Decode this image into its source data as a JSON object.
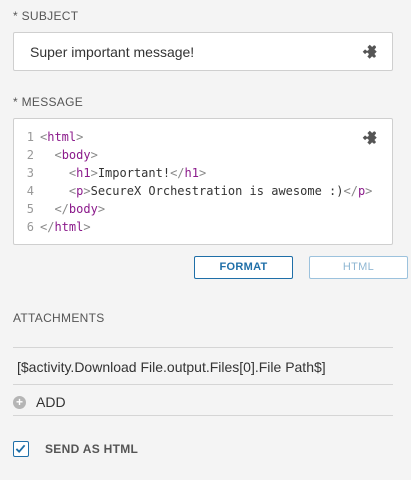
{
  "subject": {
    "label": "* SUBJECT",
    "value": "Super important message!"
  },
  "message": {
    "label": "* MESSAGE",
    "lines": [
      {
        "num": "1",
        "indent": "",
        "parts": [
          {
            "t": "br",
            "v": "<"
          },
          {
            "t": "tag",
            "v": "html"
          },
          {
            "t": "br",
            "v": ">"
          }
        ]
      },
      {
        "num": "2",
        "indent": "  ",
        "parts": [
          {
            "t": "br",
            "v": "<"
          },
          {
            "t": "tag",
            "v": "body"
          },
          {
            "t": "br",
            "v": ">"
          }
        ]
      },
      {
        "num": "3",
        "indent": "    ",
        "parts": [
          {
            "t": "br",
            "v": "<"
          },
          {
            "t": "tag",
            "v": "h1"
          },
          {
            "t": "br",
            "v": ">"
          },
          {
            "t": "txt",
            "v": "Important!"
          },
          {
            "t": "br",
            "v": "</"
          },
          {
            "t": "tag",
            "v": "h1"
          },
          {
            "t": "br",
            "v": ">"
          }
        ]
      },
      {
        "num": "4",
        "indent": "    ",
        "parts": [
          {
            "t": "br",
            "v": "<"
          },
          {
            "t": "tag",
            "v": "p"
          },
          {
            "t": "br",
            "v": ">"
          },
          {
            "t": "txt",
            "v": "SecureX Orchestration is awesome :)"
          },
          {
            "t": "br",
            "v": "</"
          },
          {
            "t": "tag",
            "v": "p"
          },
          {
            "t": "br",
            "v": ">"
          }
        ]
      },
      {
        "num": "5",
        "indent": "  ",
        "parts": [
          {
            "t": "br",
            "v": "</"
          },
          {
            "t": "tag",
            "v": "body"
          },
          {
            "t": "br",
            "v": ">"
          }
        ]
      },
      {
        "num": "6",
        "indent": "",
        "parts": [
          {
            "t": "br",
            "v": "</"
          },
          {
            "t": "tag",
            "v": "html"
          },
          {
            "t": "br",
            "v": ">"
          }
        ]
      }
    ]
  },
  "buttons": {
    "format": "FORMAT",
    "html": "HTML"
  },
  "attachments": {
    "label": "ATTACHMENTS",
    "items": [
      "[$activity.Download File.output.Files[0].File Path$]"
    ],
    "add_label": "ADD"
  },
  "send_as_html": {
    "label": "SEND AS HTML",
    "checked": true
  },
  "icons": {
    "variable": "puzzle-icon",
    "add": "plus-circle-icon",
    "check": "checkmark-icon"
  },
  "colors": {
    "accent": "#1f6fa8",
    "tag": "#8b1a8b",
    "background": "#f4f4f4"
  }
}
